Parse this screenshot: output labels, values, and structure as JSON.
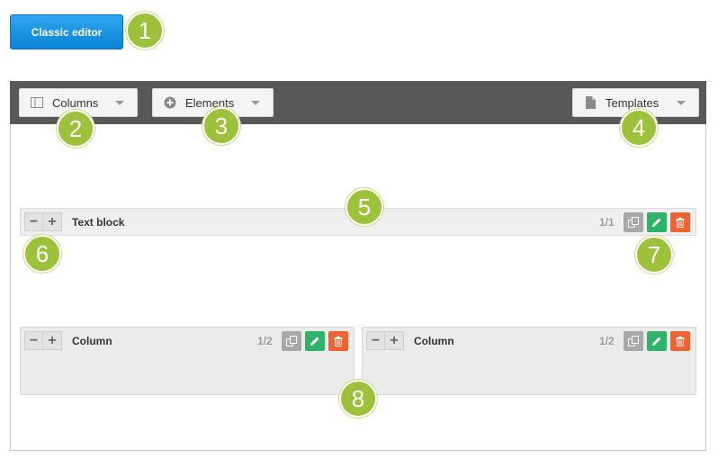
{
  "header": {
    "classic_editor_label": "Classic editor"
  },
  "toolbar": {
    "columns_label": "Columns",
    "elements_label": "Elements",
    "templates_label": "Templates"
  },
  "text_block": {
    "title": "Text block",
    "fraction": "1/1"
  },
  "columns": [
    {
      "title": "Column",
      "fraction": "1/2"
    },
    {
      "title": "Column",
      "fraction": "1/2"
    }
  ],
  "callouts": [
    "1",
    "2",
    "3",
    "4",
    "5",
    "6",
    "7",
    "8"
  ],
  "colors": {
    "accent_green": "#9dc13a",
    "button_blue": "#0a82d8",
    "edit_green": "#2fb36b",
    "delete_orange": "#ef6231",
    "toolbar_gray": "#585858"
  }
}
